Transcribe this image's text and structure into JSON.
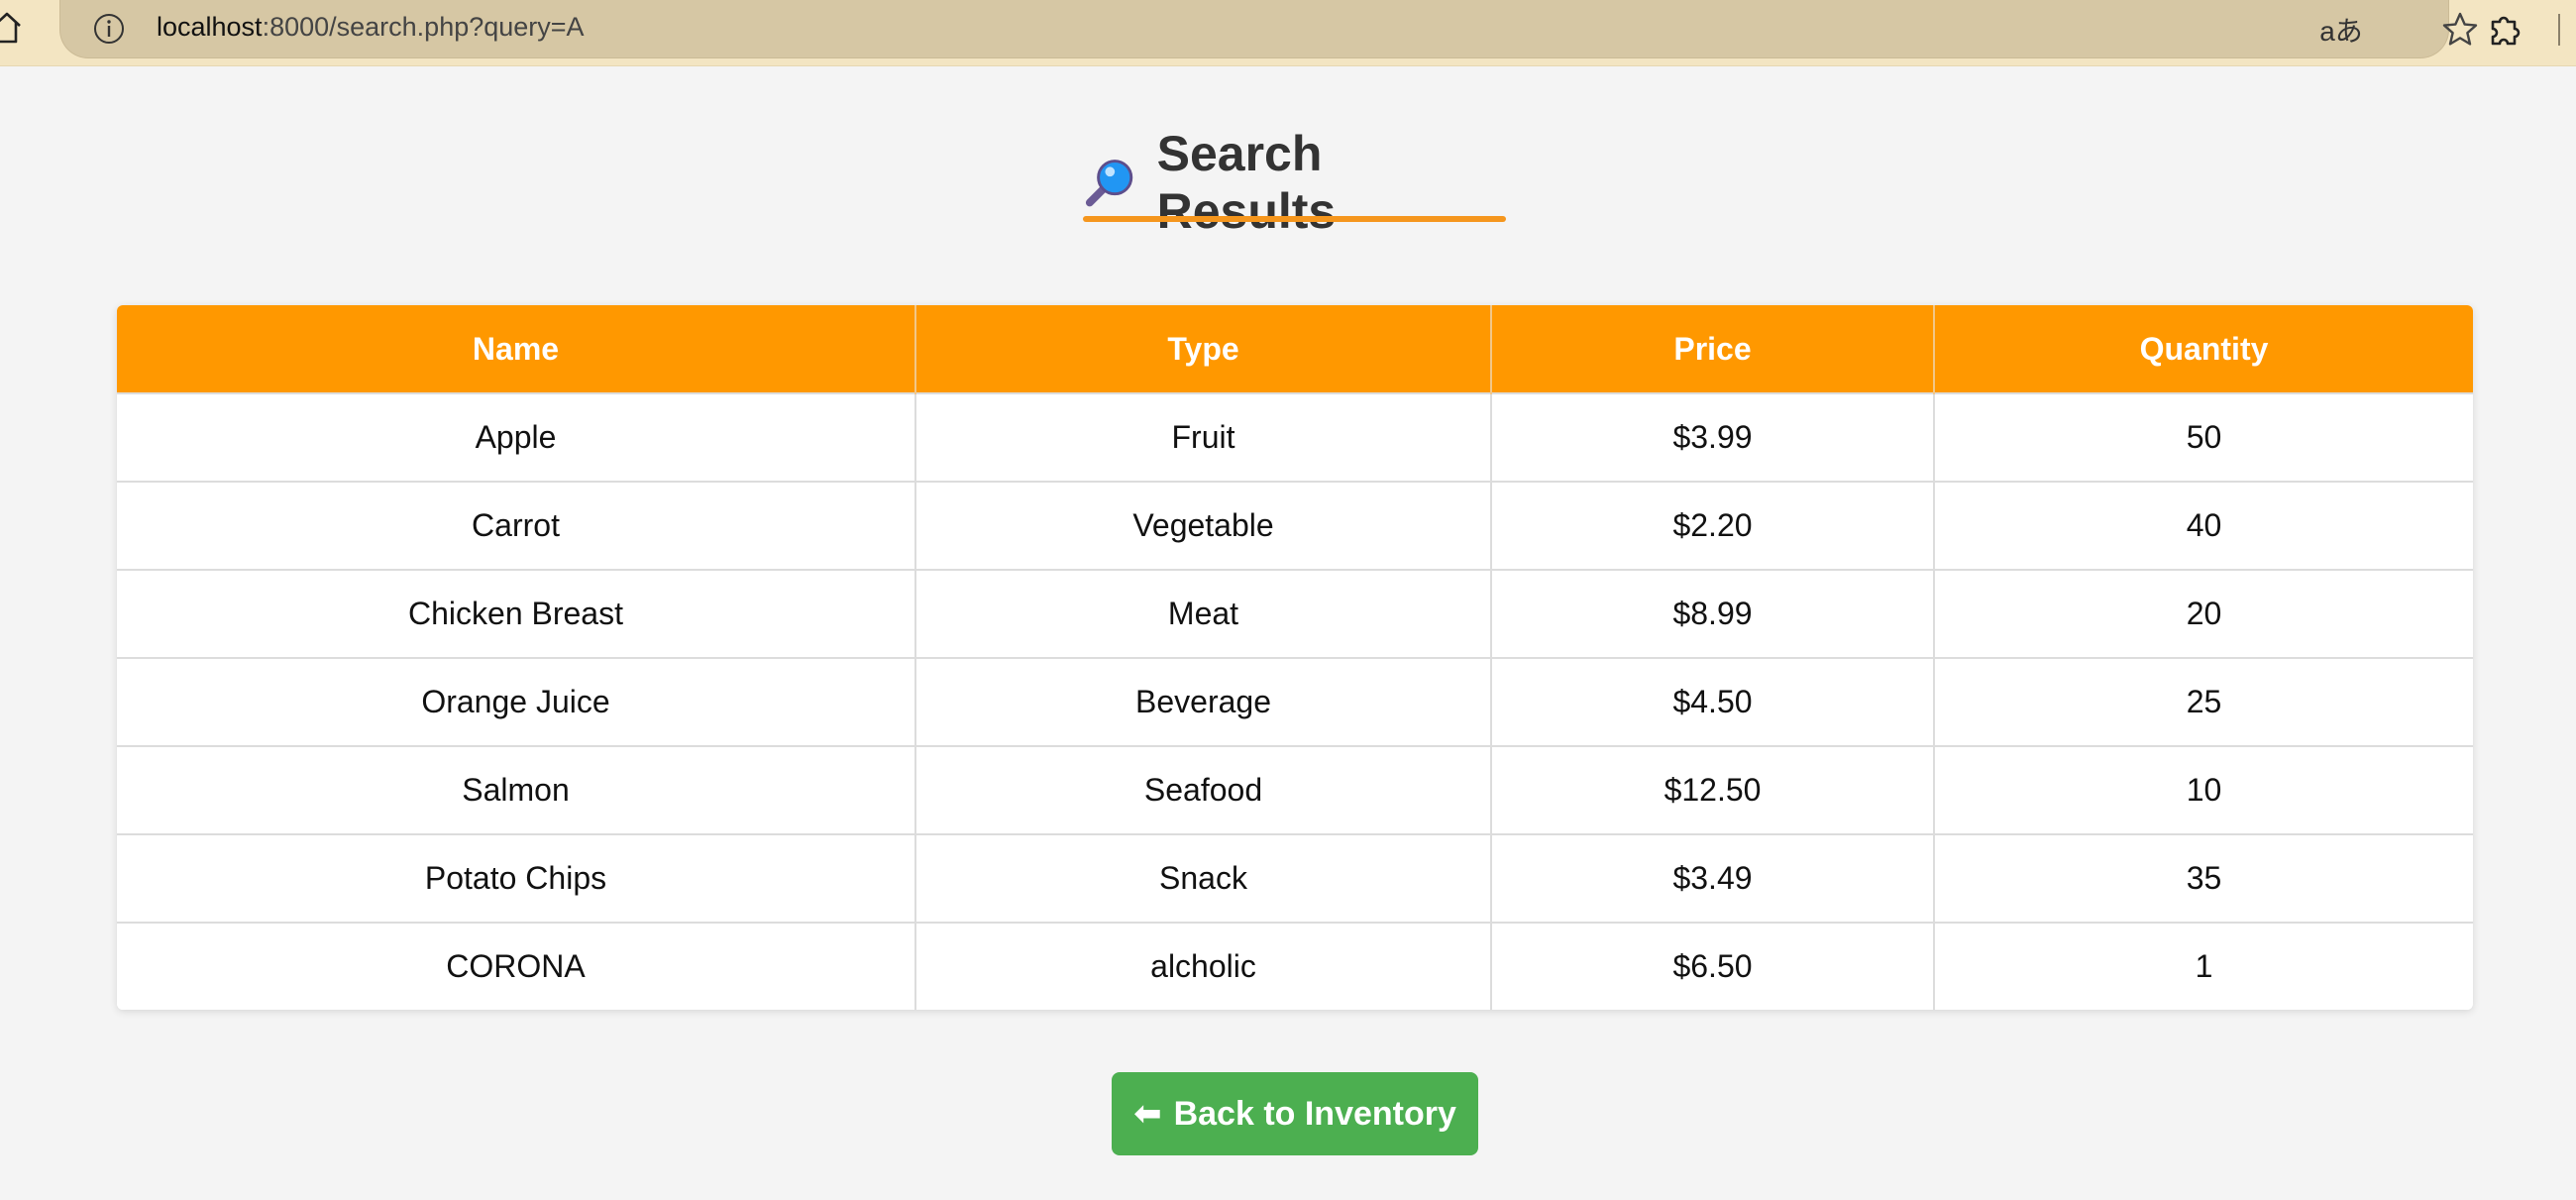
{
  "browser": {
    "url_host": "localhost",
    "url_rest": ":8000/search.php?query=A",
    "read_aloud_label": "aあ"
  },
  "page": {
    "title": "Search Results",
    "title_icon": "magnifying-glass-icon",
    "accent_color": "#ff9800",
    "button_color": "#4caf50"
  },
  "table": {
    "headers": [
      "Name",
      "Type",
      "Price",
      "Quantity"
    ],
    "rows": [
      [
        "Apple",
        "Fruit",
        "$3.99",
        "50"
      ],
      [
        "Carrot",
        "Vegetable",
        "$2.20",
        "40"
      ],
      [
        "Chicken Breast",
        "Meat",
        "$8.99",
        "20"
      ],
      [
        "Orange Juice",
        "Beverage",
        "$4.50",
        "25"
      ],
      [
        "Salmon",
        "Seafood",
        "$12.50",
        "10"
      ],
      [
        "Potato Chips",
        "Snack",
        "$3.49",
        "35"
      ],
      [
        "CORONA",
        "alcholic",
        "$6.50",
        "1"
      ]
    ]
  },
  "back_button": {
    "arrow": "⬅",
    "label": "Back to Inventory"
  }
}
